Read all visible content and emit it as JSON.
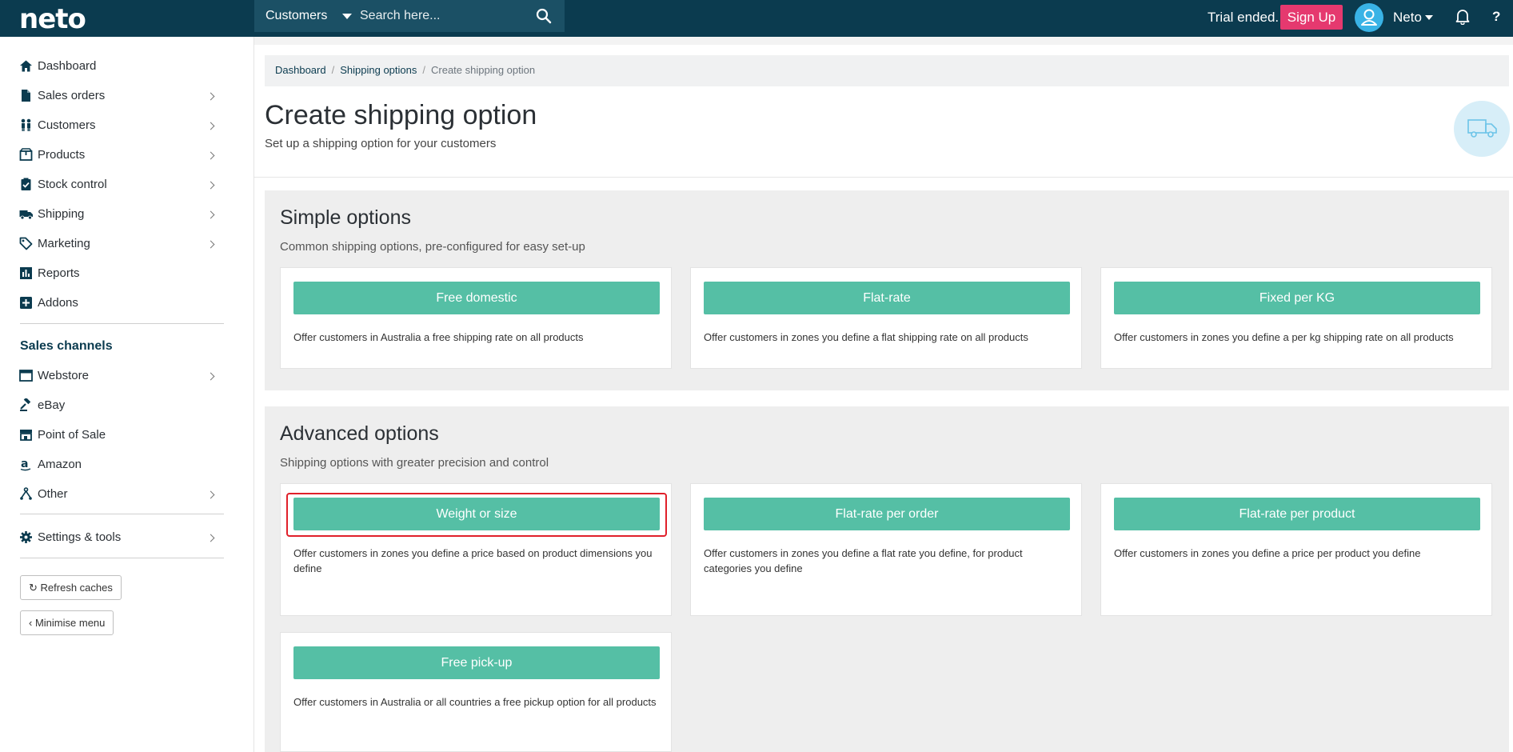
{
  "topbar": {
    "logo": "neto",
    "search_scope": "Customers",
    "search_placeholder": "Search here...",
    "trial_text": "Trial ended.",
    "signup_label": "Sign Up",
    "user_name": "Neto",
    "help_label": "?",
    "bg_color": "#0b3b4f"
  },
  "sidebar": {
    "items": [
      {
        "label": "Dashboard",
        "icon": "home-icon"
      },
      {
        "label": "Sales orders",
        "icon": "document-icon"
      },
      {
        "label": "Customers",
        "icon": "people-icon"
      },
      {
        "label": "Products",
        "icon": "box-icon"
      },
      {
        "label": "Stock control",
        "icon": "clipboard-check-icon"
      },
      {
        "label": "Shipping",
        "icon": "truck-icon"
      },
      {
        "label": "Marketing",
        "icon": "tag-icon"
      },
      {
        "label": "Reports",
        "icon": "bar-chart-icon"
      },
      {
        "label": "Addons",
        "icon": "plus-square-icon"
      }
    ],
    "channels_title": "Sales channels",
    "channels": [
      {
        "label": "Webstore",
        "icon": "browser-icon"
      },
      {
        "label": "eBay",
        "icon": "gavel-icon"
      },
      {
        "label": "Point of Sale",
        "icon": "store-icon"
      },
      {
        "label": "Amazon",
        "icon": "amazon-icon"
      },
      {
        "label": "Other",
        "icon": "sitemap-icon"
      }
    ],
    "settings_label": "Settings & tools",
    "refresh_label": "Refresh caches",
    "minimise_label": "Minimise menu"
  },
  "breadcrumb": {
    "items": [
      "Dashboard",
      "Shipping options"
    ],
    "current": "Create shipping option"
  },
  "page": {
    "title": "Create shipping option",
    "subtitle": "Set up a shipping option for your customers"
  },
  "simple": {
    "title": "Simple options",
    "description": "Common shipping options, pre-configured for easy set-up",
    "cards": [
      {
        "button": "Free domestic",
        "description": "Offer customers in Australia a free shipping rate on all products"
      },
      {
        "button": "Flat-rate",
        "description": "Offer customers in zones you define a flat shipping rate on all products"
      },
      {
        "button": "Fixed per KG",
        "description": "Offer customers in zones you define a per kg shipping rate on all products"
      }
    ]
  },
  "advanced": {
    "title": "Advanced options",
    "description": "Shipping options with greater precision and control",
    "cards": [
      {
        "button": "Weight or size",
        "description": "Offer customers in zones you define a price based on product dimensions you define"
      },
      {
        "button": "Flat-rate per order",
        "description": "Offer customers in zones you define a flat rate you define, for product categories you define"
      },
      {
        "button": "Flat-rate per product",
        "description": "Offer customers in zones you define a price per product you define"
      },
      {
        "button": "Free pick-up",
        "description": "Offer customers in Australia or all countries a free pickup option for all products"
      }
    ]
  },
  "colors": {
    "accent_button": "#55bfa5",
    "signup": "#e5396f",
    "highlight": "#e0202a"
  }
}
